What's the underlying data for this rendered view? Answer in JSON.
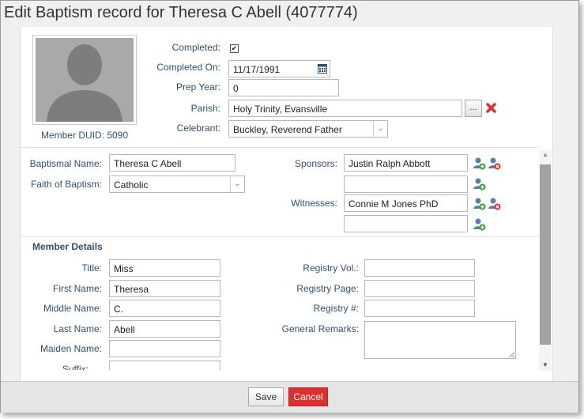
{
  "dialog": {
    "title": "Edit Baptism record for Theresa C Abell (4077774)"
  },
  "profile": {
    "member_duid": "Member DUID: 5090"
  },
  "record": {
    "completed_label": "Completed:",
    "completed_checked": true,
    "completed_on_label": "Completed On:",
    "completed_on_value": "11/17/1991",
    "prep_year_label": "Prep Year:",
    "prep_year_value": "0",
    "parish_label": "Parish:",
    "parish_value": "Holy Trinity, Evansville",
    "parish_browse": "...",
    "celebrant_label": "Celebrant:",
    "celebrant_value": "Buckley, Reverend Father"
  },
  "baptism": {
    "baptismal_name_label": "Baptismal Name:",
    "baptismal_name_value": "Theresa C Abell",
    "faith_label": "Faith of Baptism:",
    "faith_value": "Catholic",
    "sponsors_label": "Sponsors:",
    "sponsors": [
      "Justin Ralph Abbott",
      ""
    ],
    "witnesses_label": "Witnesses:",
    "witnesses": [
      "Connie M Jones PhD",
      ""
    ]
  },
  "member_details": {
    "section_title": "Member Details",
    "title_label": "Title:",
    "title_value": "Miss",
    "first_name_label": "First Name:",
    "first_name_value": "Theresa",
    "middle_name_label": "Middle Name:",
    "middle_name_value": "C.",
    "last_name_label": "Last Name:",
    "last_name_value": "Abell",
    "maiden_name_label": "Maiden Name:",
    "maiden_name_value": "",
    "suffix_label": "Suffix:",
    "suffix_value": "",
    "registry_vol_label": "Registry Vol.:",
    "registry_vol_value": "",
    "registry_page_label": "Registry Page:",
    "registry_page_value": "",
    "registry_num_label": "Registry #:",
    "registry_num_value": "",
    "general_remarks_label": "General Remarks:",
    "general_remarks_value": ""
  },
  "footer": {
    "save_label": "Save",
    "cancel_label": "Cancel"
  },
  "colors": {
    "label_text": "#35506b",
    "cancel_bg": "#d9312e",
    "add_person_icon": "#5a7fa8",
    "add_badge": "#3f9e3a",
    "remove_badge": "#d9312e"
  },
  "icons": {
    "calendar": "calendar-icon",
    "clear": "red-x-icon",
    "add_person": "add-person-icon",
    "remove_person": "remove-person-icon"
  }
}
